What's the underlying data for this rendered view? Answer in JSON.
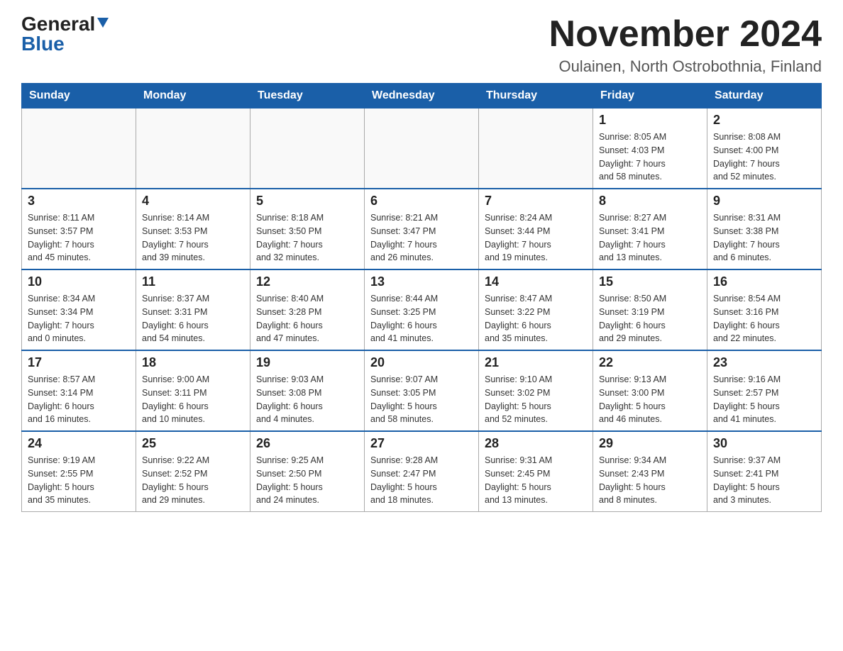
{
  "header": {
    "logo_general": "General",
    "logo_blue": "Blue",
    "month_year": "November 2024",
    "location": "Oulainen, North Ostrobothnia, Finland"
  },
  "weekdays": [
    "Sunday",
    "Monday",
    "Tuesday",
    "Wednesday",
    "Thursday",
    "Friday",
    "Saturday"
  ],
  "weeks": [
    [
      {
        "day": "",
        "info": ""
      },
      {
        "day": "",
        "info": ""
      },
      {
        "day": "",
        "info": ""
      },
      {
        "day": "",
        "info": ""
      },
      {
        "day": "",
        "info": ""
      },
      {
        "day": "1",
        "info": "Sunrise: 8:05 AM\nSunset: 4:03 PM\nDaylight: 7 hours\nand 58 minutes."
      },
      {
        "day": "2",
        "info": "Sunrise: 8:08 AM\nSunset: 4:00 PM\nDaylight: 7 hours\nand 52 minutes."
      }
    ],
    [
      {
        "day": "3",
        "info": "Sunrise: 8:11 AM\nSunset: 3:57 PM\nDaylight: 7 hours\nand 45 minutes."
      },
      {
        "day": "4",
        "info": "Sunrise: 8:14 AM\nSunset: 3:53 PM\nDaylight: 7 hours\nand 39 minutes."
      },
      {
        "day": "5",
        "info": "Sunrise: 8:18 AM\nSunset: 3:50 PM\nDaylight: 7 hours\nand 32 minutes."
      },
      {
        "day": "6",
        "info": "Sunrise: 8:21 AM\nSunset: 3:47 PM\nDaylight: 7 hours\nand 26 minutes."
      },
      {
        "day": "7",
        "info": "Sunrise: 8:24 AM\nSunset: 3:44 PM\nDaylight: 7 hours\nand 19 minutes."
      },
      {
        "day": "8",
        "info": "Sunrise: 8:27 AM\nSunset: 3:41 PM\nDaylight: 7 hours\nand 13 minutes."
      },
      {
        "day": "9",
        "info": "Sunrise: 8:31 AM\nSunset: 3:38 PM\nDaylight: 7 hours\nand 6 minutes."
      }
    ],
    [
      {
        "day": "10",
        "info": "Sunrise: 8:34 AM\nSunset: 3:34 PM\nDaylight: 7 hours\nand 0 minutes."
      },
      {
        "day": "11",
        "info": "Sunrise: 8:37 AM\nSunset: 3:31 PM\nDaylight: 6 hours\nand 54 minutes."
      },
      {
        "day": "12",
        "info": "Sunrise: 8:40 AM\nSunset: 3:28 PM\nDaylight: 6 hours\nand 47 minutes."
      },
      {
        "day": "13",
        "info": "Sunrise: 8:44 AM\nSunset: 3:25 PM\nDaylight: 6 hours\nand 41 minutes."
      },
      {
        "day": "14",
        "info": "Sunrise: 8:47 AM\nSunset: 3:22 PM\nDaylight: 6 hours\nand 35 minutes."
      },
      {
        "day": "15",
        "info": "Sunrise: 8:50 AM\nSunset: 3:19 PM\nDaylight: 6 hours\nand 29 minutes."
      },
      {
        "day": "16",
        "info": "Sunrise: 8:54 AM\nSunset: 3:16 PM\nDaylight: 6 hours\nand 22 minutes."
      }
    ],
    [
      {
        "day": "17",
        "info": "Sunrise: 8:57 AM\nSunset: 3:14 PM\nDaylight: 6 hours\nand 16 minutes."
      },
      {
        "day": "18",
        "info": "Sunrise: 9:00 AM\nSunset: 3:11 PM\nDaylight: 6 hours\nand 10 minutes."
      },
      {
        "day": "19",
        "info": "Sunrise: 9:03 AM\nSunset: 3:08 PM\nDaylight: 6 hours\nand 4 minutes."
      },
      {
        "day": "20",
        "info": "Sunrise: 9:07 AM\nSunset: 3:05 PM\nDaylight: 5 hours\nand 58 minutes."
      },
      {
        "day": "21",
        "info": "Sunrise: 9:10 AM\nSunset: 3:02 PM\nDaylight: 5 hours\nand 52 minutes."
      },
      {
        "day": "22",
        "info": "Sunrise: 9:13 AM\nSunset: 3:00 PM\nDaylight: 5 hours\nand 46 minutes."
      },
      {
        "day": "23",
        "info": "Sunrise: 9:16 AM\nSunset: 2:57 PM\nDaylight: 5 hours\nand 41 minutes."
      }
    ],
    [
      {
        "day": "24",
        "info": "Sunrise: 9:19 AM\nSunset: 2:55 PM\nDaylight: 5 hours\nand 35 minutes."
      },
      {
        "day": "25",
        "info": "Sunrise: 9:22 AM\nSunset: 2:52 PM\nDaylight: 5 hours\nand 29 minutes."
      },
      {
        "day": "26",
        "info": "Sunrise: 9:25 AM\nSunset: 2:50 PM\nDaylight: 5 hours\nand 24 minutes."
      },
      {
        "day": "27",
        "info": "Sunrise: 9:28 AM\nSunset: 2:47 PM\nDaylight: 5 hours\nand 18 minutes."
      },
      {
        "day": "28",
        "info": "Sunrise: 9:31 AM\nSunset: 2:45 PM\nDaylight: 5 hours\nand 13 minutes."
      },
      {
        "day": "29",
        "info": "Sunrise: 9:34 AM\nSunset: 2:43 PM\nDaylight: 5 hours\nand 8 minutes."
      },
      {
        "day": "30",
        "info": "Sunrise: 9:37 AM\nSunset: 2:41 PM\nDaylight: 5 hours\nand 3 minutes."
      }
    ]
  ]
}
